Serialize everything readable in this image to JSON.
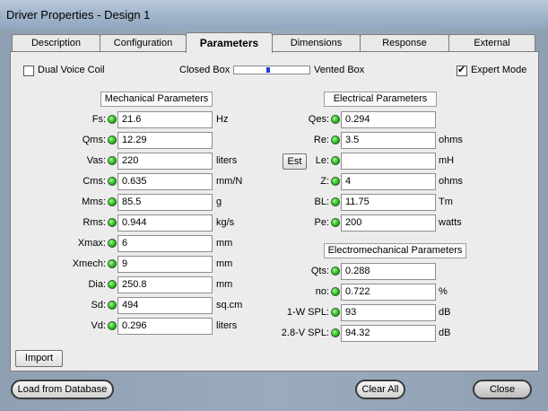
{
  "window": {
    "title": "Driver Properties - Design 1"
  },
  "tabs": [
    {
      "label": "Description",
      "active": false
    },
    {
      "label": "Configuration",
      "active": false
    },
    {
      "label": "Parameters",
      "active": true
    },
    {
      "label": "Dimensions",
      "active": false
    },
    {
      "label": "Response",
      "active": false
    },
    {
      "label": "External",
      "active": false
    }
  ],
  "options": {
    "dual_voice_coil": {
      "label": "Dual Voice Coil",
      "checked": false
    },
    "box_slider": {
      "left_label": "Closed Box",
      "right_label": "Vented Box",
      "position": 0.45
    },
    "expert_mode": {
      "label": "Expert Mode",
      "checked": true
    }
  },
  "mechanical": {
    "header": "Mechanical Parameters",
    "rows": [
      {
        "label": "Fs:",
        "value": "21.6",
        "unit": "Hz"
      },
      {
        "label": "Qms:",
        "value": "12.29",
        "unit": ""
      },
      {
        "label": "Vas:",
        "value": "220",
        "unit": "liters"
      },
      {
        "label": "Cms:",
        "value": "0.635",
        "unit": "mm/N"
      },
      {
        "label": "Mms:",
        "value": "85.5",
        "unit": "g"
      },
      {
        "label": "Rms:",
        "value": "0.944",
        "unit": "kg/s"
      },
      {
        "label": "Xmax:",
        "value": "6",
        "unit": "mm"
      },
      {
        "label": "Xmech:",
        "value": "9",
        "unit": "mm"
      },
      {
        "label": "Dia:",
        "value": "250.8",
        "unit": "mm"
      },
      {
        "label": "Sd:",
        "value": "494",
        "unit": "sq.cm"
      },
      {
        "label": "Vd:",
        "value": "0.296",
        "unit": "liters"
      }
    ]
  },
  "electrical": {
    "header": "Electrical Parameters",
    "est_label": "Est",
    "rows": [
      {
        "label": "Qes:",
        "value": "0.294",
        "unit": ""
      },
      {
        "label": "Re:",
        "value": "3.5",
        "unit": "ohms"
      },
      {
        "label": "Le:",
        "value": "",
        "unit": "mH"
      },
      {
        "label": "Z:",
        "value": "4",
        "unit": "ohms"
      },
      {
        "label": "BL:",
        "value": "11.75",
        "unit": "Tm"
      },
      {
        "label": "Pe:",
        "value": "200",
        "unit": "watts"
      }
    ]
  },
  "electromechanical": {
    "header": "Electromechanical Parameters",
    "rows": [
      {
        "label": "Qts:",
        "value": "0.288",
        "unit": ""
      },
      {
        "label": "no:",
        "value": "0.722",
        "unit": "%"
      },
      {
        "label": "1-W SPL:",
        "value": "93",
        "unit": "dB"
      },
      {
        "label": "2.8-V SPL:",
        "value": "94.32",
        "unit": "dB"
      }
    ]
  },
  "buttons": {
    "import": "Import",
    "load_from_database": "Load from Database",
    "clear_all": "Clear All",
    "close": "Close"
  }
}
